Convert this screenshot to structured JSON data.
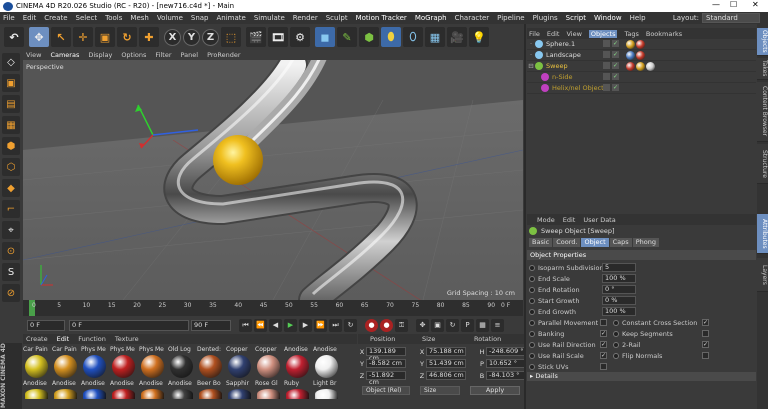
{
  "window": {
    "title": "CINEMA 4D R20.026 Studio (RC - R20) - [new716.c4d *] - Main",
    "minimize": "—",
    "maximize": "☐",
    "close": "✕"
  },
  "menu": {
    "items": [
      "File",
      "Edit",
      "Create",
      "Select",
      "Tools",
      "Mesh",
      "Volume",
      "Snap",
      "Animate",
      "Simulate",
      "Render",
      "Sculpt",
      "Motion Tracker",
      "MoGraph",
      "Character",
      "Pipeline",
      "Plugins",
      "Script",
      "Window",
      "Help"
    ],
    "layout_label": "Layout:",
    "layout_value": "Standard"
  },
  "viewport": {
    "menu": [
      "View",
      "Cameras",
      "Display",
      "Options",
      "Filter",
      "Panel",
      "ProRender"
    ],
    "label": "Perspective",
    "grid_spacing": "Grid Spacing : 10 cm"
  },
  "timeline": {
    "ticks": [
      "0",
      "5",
      "10",
      "15",
      "20",
      "25",
      "30",
      "35",
      "40",
      "45",
      "50",
      "55",
      "60",
      "65",
      "70",
      "75",
      "80",
      "85",
      "90"
    ],
    "end_label": "0 F"
  },
  "transport": {
    "current_frame": "0 F",
    "min_frame": "0 F",
    "max_frame": "90 F",
    "end_frame": "90 F"
  },
  "materials": {
    "menu": [
      "Create",
      "Edit",
      "Function",
      "Texture"
    ],
    "top_row": [
      {
        "label": "Car Pain",
        "color": "#c43a2a"
      },
      {
        "label": "Car Pain",
        "color": "#d4a020"
      },
      {
        "label": "Phys Me",
        "color": "#8a8a8a"
      },
      {
        "label": "Phys Me",
        "color": "#b02020"
      },
      {
        "label": "Phys Me",
        "color": "#c8a040"
      },
      {
        "label": "Old Log",
        "color": "#2a2a2a"
      },
      {
        "label": "Dented:",
        "color": "#555555"
      },
      {
        "label": "Copper",
        "color": "#b36a3a"
      },
      {
        "label": "Copper",
        "color": "#a85a2a"
      },
      {
        "label": "Anodise",
        "color": "#9a2030"
      },
      {
        "label": "Anodise",
        "color": "#ffffff"
      }
    ],
    "bottom_row": [
      {
        "label": "Anodise",
        "color": "#d4c020"
      },
      {
        "label": "Anodise",
        "color": "#d49020"
      },
      {
        "label": "Anodise",
        "color": "#2050c0"
      },
      {
        "label": "Anodise",
        "color": "#c02020"
      },
      {
        "label": "Anodise",
        "color": "#d07020"
      },
      {
        "label": "Anodise",
        "color": "#303030"
      },
      {
        "label": "Beer Bo",
        "color": "#b05020"
      },
      {
        "label": "Sapphir",
        "color": "#304070"
      },
      {
        "label": "Rose Gl",
        "color": "#d09080"
      },
      {
        "label": "Ruby",
        "color": "#c02030"
      },
      {
        "label": "Light Br",
        "color": "#f0f0f0"
      }
    ],
    "third_row_colors": [
      "#d4c020",
      "#d4a020",
      "#2050c0",
      "#c02020",
      "#d07020",
      "#404040",
      "#b05020",
      "#304070",
      "#d09080",
      "#c02030",
      "#f0f0f0"
    ]
  },
  "coordinates": {
    "headers": [
      "Position",
      "Size",
      "Rotation"
    ],
    "rows": [
      {
        "axis": "X",
        "pos": "139.189 cm",
        "size_axis": "X",
        "size": "75.188 cm",
        "rot_axis": "H",
        "rot": "-248.609 °"
      },
      {
        "axis": "Y",
        "pos": "-8.582 cm",
        "size_axis": "Y",
        "size": "51.439 cm",
        "rot_axis": "P",
        "rot": "10.652 °"
      },
      {
        "axis": "Z",
        "pos": "-51.892 cm",
        "size_axis": "Z",
        "size": "46.806 cm",
        "rot_axis": "B",
        "rot": "-84.103 °"
      }
    ],
    "mode": "Object (Rel)",
    "size_mode": "Size",
    "apply": "Apply"
  },
  "object_manager": {
    "menu": [
      "File",
      "Edit",
      "View",
      "Objects",
      "Tags",
      "Bookmarks"
    ],
    "objects": [
      {
        "name": "Sphere.1",
        "color": "#88c8f0",
        "indent": 0,
        "name_color": "#dddddd",
        "tags": [
          "#d4a020",
          "#c43a2a"
        ]
      },
      {
        "name": "Landscape",
        "color": "#88c8f0",
        "indent": 0,
        "name_color": "#dddddd",
        "tags": [
          "#4a7abf",
          "#c43a2a"
        ]
      },
      {
        "name": "Sweep",
        "color": "#7cc142",
        "indent": 0,
        "name_color": "#e8c040",
        "tags": [
          "#c43a2a",
          "#d4a020",
          "#cccccc"
        ]
      },
      {
        "name": "n-Side",
        "color": "#c040c0",
        "indent": 1,
        "name_color": "#c0a030",
        "tags": []
      },
      {
        "name": "Helix/nel Object",
        "color": "#c040c0",
        "indent": 1,
        "name_color": "#c0a030",
        "tags": []
      }
    ]
  },
  "attribute_manager": {
    "menu": [
      "Mode",
      "Edit",
      "User Data"
    ],
    "title": "Sweep Object [Sweep]",
    "tabs": [
      "Basic",
      "Coord.",
      "Object",
      "Caps",
      "Phong"
    ],
    "active_tab": "Object",
    "section": "Object Properties",
    "fields": [
      {
        "label": "Isoparm Subdivision",
        "value": "5"
      },
      {
        "label": "End Scale",
        "value": "100 %"
      },
      {
        "label": "End Rotation",
        "value": "0 °"
      },
      {
        "label": "Start Growth",
        "value": "0 %"
      },
      {
        "label": "End Growth",
        "value": "100 %"
      }
    ],
    "checks_left": [
      {
        "label": "Parallel Movement",
        "checked": ""
      },
      {
        "label": "Banking",
        "checked": "✓"
      },
      {
        "label": "Use Rail Direction",
        "checked": "✓"
      },
      {
        "label": "Use Rail Scale",
        "checked": "✓"
      },
      {
        "label": "Stick UVs",
        "checked": ""
      }
    ],
    "checks_right": [
      {
        "label": "Constant Cross Section",
        "checked": "✓"
      },
      {
        "label": "Keep Segments",
        "checked": ""
      },
      {
        "label": "2-Rail",
        "checked": "✓"
      },
      {
        "label": "Flip Normals",
        "checked": ""
      }
    ],
    "details": "▸ Details"
  },
  "side_tabs": [
    "Objects",
    "Takes",
    "Content Browser",
    "Structure",
    "Attributes",
    "Layers"
  ],
  "logo": "MAXON CINEMA 4D"
}
